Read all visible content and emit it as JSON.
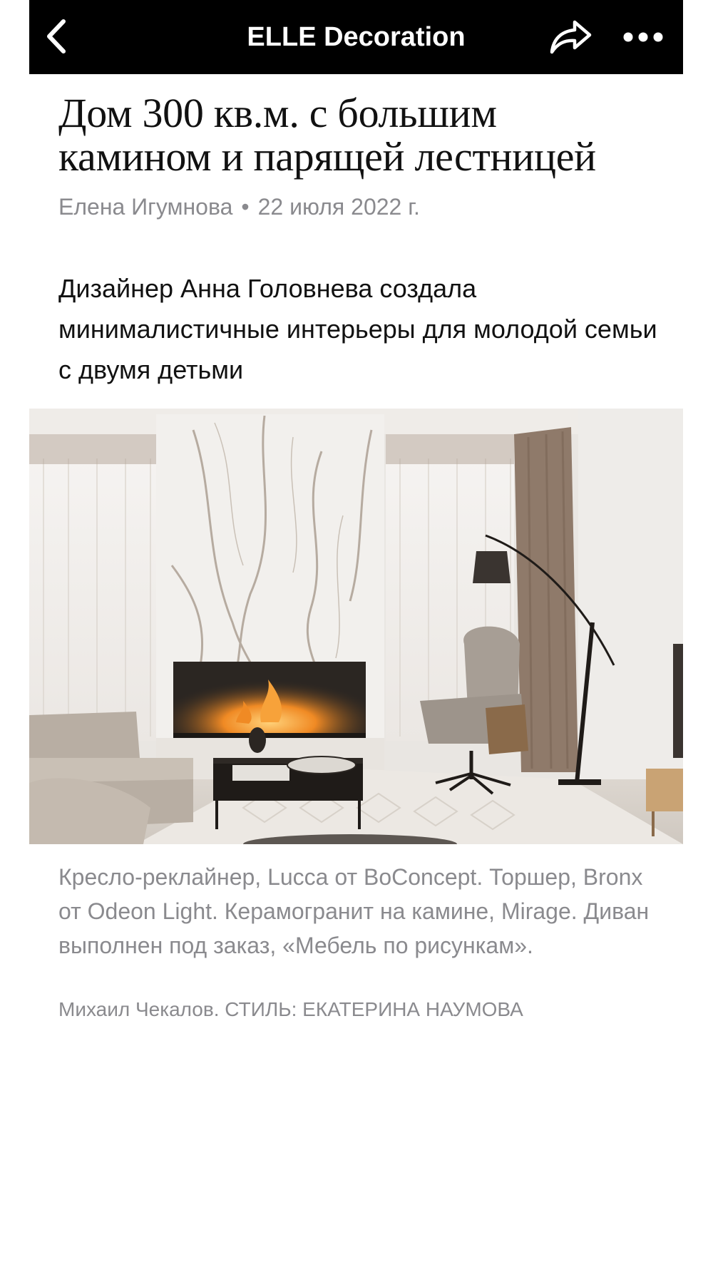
{
  "header": {
    "title": "ELLE Decoration",
    "back_icon": "chevron-left-icon",
    "share_icon": "share-arrow-icon",
    "more_icon": "more-dots-icon",
    "background": "#000000"
  },
  "article": {
    "headline": "Дом 300 кв.м. с большим камином и парящей лестницей",
    "author": "Елена Игумнова",
    "separator": "•",
    "date": "22 июля 2022 г.",
    "lede": "Дизайнер Анна Головнева создала минималистичные интерьеры для молодой семьи с двумя детьми",
    "caption": "Кресло-реклайнер, Lucca от BoConcept. Торшер, Bronx от Odeon Light. Керамогранит на камине, Mirage. Диван выполнен под заказ, «Мебель по рисункам».",
    "credit": "Михаил Чекалов. СТИЛЬ: ЕКАТЕРИНА НАУМОВА"
  },
  "colors": {
    "meta_text": "#8a8a8e",
    "body_text": "#111111"
  }
}
